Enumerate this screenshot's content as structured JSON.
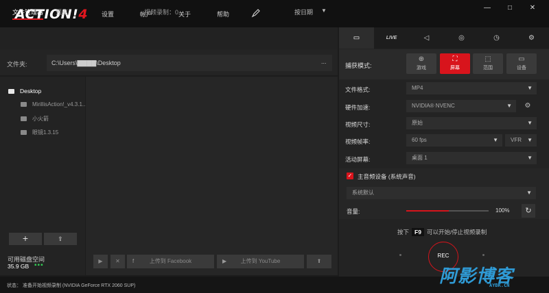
{
  "app": {
    "logo": "ACTION!",
    "logo_version": "4",
    "menu": [
      "设置",
      "帐户",
      "关于",
      "帮助"
    ],
    "window_controls": [
      "—",
      "□",
      "✕"
    ]
  },
  "left": {
    "tabs": [
      "文件管理器",
      "预览"
    ],
    "recording_count": "视频录制：0",
    "sort_label": "按日期",
    "folder_label": "文件夹:",
    "folder_path": "C:\\Users\\▇▇▇▇\\Desktop",
    "folder_more": "...",
    "tree": [
      {
        "label": "Desktop",
        "root": true
      },
      {
        "label": "MirillisAction!_v4.3.1...",
        "root": false
      },
      {
        "label": "小火箭",
        "root": false
      },
      {
        "label": "眼镜1.3.15",
        "root": false
      }
    ],
    "add_button": "+",
    "import_button": "⇪",
    "disk_label": "可用磁盘空间",
    "disk_size": "35.9 GB",
    "disk_indicator": "▪▪▪",
    "content_buttons": {
      "play": "▶",
      "delete": "✕",
      "facebook": "上传到 Facebook",
      "youtube": "上传到 YouTube",
      "upload": "⬆"
    }
  },
  "status": {
    "text": "状态：   准备开始视频录制 (NVIDIA GeForce RTX 2060 SUP)"
  },
  "right": {
    "tabs": [
      {
        "icon": "film-icon",
        "glyph": "▭"
      },
      {
        "icon": "live-icon",
        "glyph": "LIVE"
      },
      {
        "icon": "speaker-icon",
        "glyph": "◁"
      },
      {
        "icon": "camera-icon",
        "glyph": "◎"
      },
      {
        "icon": "timer-icon",
        "glyph": "◷"
      },
      {
        "icon": "gear-icon",
        "glyph": "⚙"
      }
    ],
    "capture_label": "捕获模式:",
    "capture_modes": [
      {
        "label": "游戏",
        "glyph": "⊕",
        "active": false
      },
      {
        "label": "屏幕",
        "glyph": "⛶",
        "active": true
      },
      {
        "label": "范围",
        "glyph": "⬚",
        "active": false
      },
      {
        "label": "设备",
        "glyph": "▭",
        "active": false
      }
    ],
    "settings": {
      "format_label": "文件格式:",
      "format_value": "MP4",
      "hw_label": "硬件加速:",
      "hw_value": "NVIDIA® NVENC",
      "size_label": "视频尺寸:",
      "size_value": "原始",
      "fps_label": "视频帧率:",
      "fps_value": "60 fps",
      "fps_mode": "VFR",
      "screen_label": "活动屏幕:",
      "screen_value": "桌面 1"
    },
    "audio": {
      "check": "✓",
      "label": "主音频设备 (系统声音)",
      "device": "系统默认",
      "volume_label": "音量:",
      "volume_value": "100%",
      "volume_fraction": 0.52,
      "reset": "↻"
    },
    "hotkey_prefix": "按下",
    "hotkey_key": "F9",
    "hotkey_suffix": "可以开始/停止视频录制",
    "rec_label": "REC"
  },
  "watermark": {
    "text": "阿影博客",
    "sub": "AYBK.CN"
  },
  "colors": {
    "accent": "#d8141c",
    "watermark": "#2f9bd6",
    "disk_ok": "#33cc55"
  }
}
